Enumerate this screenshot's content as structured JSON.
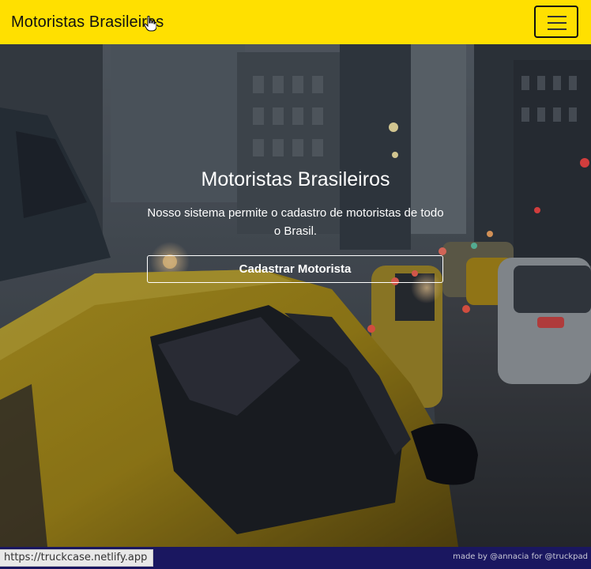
{
  "navbar": {
    "brand": "Motoristas Brasileiros",
    "bg_color": "#ffe000"
  },
  "hero": {
    "title": "Motoristas Brasileiros",
    "description": "Nosso sistema permite o cadastro de motoristas de todo o Brasil.",
    "cta_label": "Cadastrar Motorista"
  },
  "footer": {
    "credit": "made by @annacia for @truckpad",
    "bg_color": "#1a1760"
  },
  "status_bar": {
    "url": "https://truckcase.netlify.app"
  }
}
